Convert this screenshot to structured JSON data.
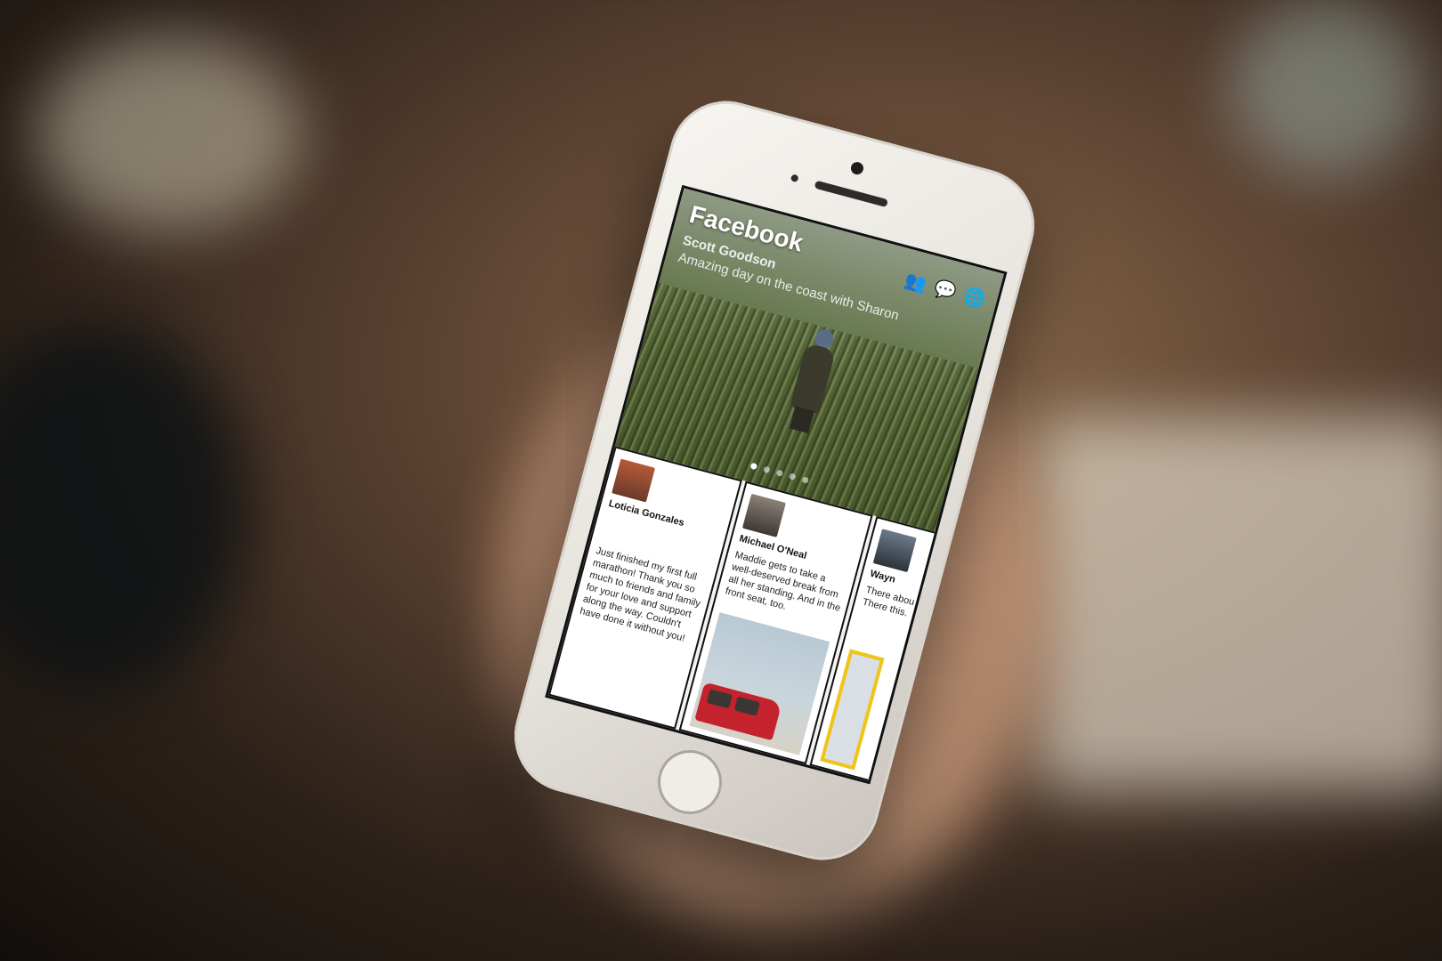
{
  "app": {
    "title": "Facebook"
  },
  "featured_post": {
    "author": "Scott Goodson",
    "caption": "Amazing day on the coast with Sharon",
    "page_dots": 5,
    "active_dot": 1
  },
  "header_icons": [
    "friends-icon",
    "messages-icon",
    "globe-icon"
  ],
  "cards": [
    {
      "name": "Loticia Gonzales",
      "text": "Just finished my first full marathon! Thank you so much to friends and family for your love and support along the way. Couldn't have done it without you!"
    },
    {
      "name": "Michael O'Neal",
      "text": "Maddie gets to take a well-deserved break from all her standing. And in the front seat, too."
    },
    {
      "name": "Wayn",
      "text": "There abou There this."
    }
  ],
  "colors": {
    "accent_yellow": "#f0c419",
    "car_red": "#c4222c"
  }
}
